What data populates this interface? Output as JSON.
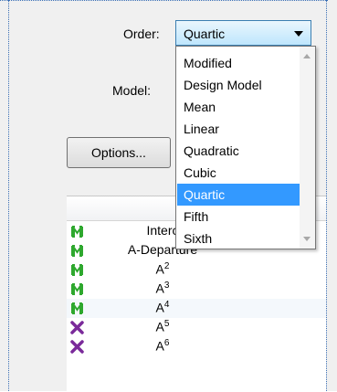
{
  "order": {
    "label": "Order:",
    "value": "Quartic"
  },
  "model": {
    "label": "Model:"
  },
  "options_button": {
    "label": "Options..."
  },
  "dropdown": {
    "items": [
      "Modified",
      "Design Model",
      "Mean",
      "Linear",
      "Quadratic",
      "Cubic",
      "Quartic",
      "Fifth",
      "Sixth"
    ],
    "selected": "Quartic"
  },
  "terms": [
    {
      "name": "Interc",
      "sup": "",
      "status": "model"
    },
    {
      "name": "A-Departure",
      "sup": "",
      "status": "model"
    },
    {
      "name": "A",
      "sup": "2",
      "status": "model"
    },
    {
      "name": "A",
      "sup": "3",
      "status": "model"
    },
    {
      "name": "A",
      "sup": "4",
      "status": "model"
    },
    {
      "name": "A",
      "sup": "5",
      "status": "excluded"
    },
    {
      "name": "A",
      "sup": "6",
      "status": "excluded"
    }
  ],
  "colors": {
    "accent": "#3399ff",
    "model_icon": "#2ea82e",
    "excluded_icon": "#7a2a9a"
  },
  "icons": {
    "model": "model-term-icon",
    "excluded": "excluded-term-icon"
  }
}
